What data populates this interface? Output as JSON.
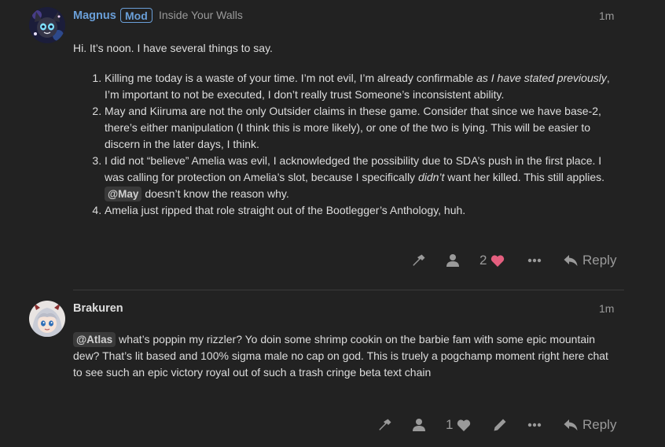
{
  "posts": [
    {
      "username": "Magnus",
      "badge": "Mod",
      "user_title": "Inside Your Walls",
      "time": "1m",
      "intro": "Hi. It’s noon. I have several things to say.",
      "list": {
        "item1_a": "Killing me today is a waste of your time. I’m not evil, I’m already confirmable ",
        "item1_em": "as I have stated previously",
        "item1_b": ", I’m important to not be executed, I don’t really trust Someone’s inconsistent ability.",
        "item2": "May and Kiiruma are not the only Outsider claims in these game. Consider that since we have base-2, there’s either manipulation (I think this is more likely), or one of the two is lying. This will be easier to discern in the later days, I think.",
        "item3_a": "I did not “believe” Amelia was evil, I acknowledged the possibility due to SDA’s push in the first place. I was calling for protection on Amelia’s slot, because I specifically ",
        "item3_em": "didn’t",
        "item3_b": " want her killed. This still applies. ",
        "item3_mention": "@May",
        "item3_c": " doesn’t know the reason why.",
        "item4": "Amelia just ripped that role straight out of the Bootlegger’s Anthology, huh."
      },
      "like_count": "2",
      "reply_label": "Reply",
      "accent_color": "#6a9fd8",
      "like_color": "#e45f7f"
    },
    {
      "username": "Brakuren",
      "time": "1m",
      "mention": "@Atlas",
      "text": " what’s poppin my rizzler? Yo doin some shrimp cookin on the barbie fam with some epic mountain dew? That’s lit based and 100% sigma male no cap on god. This is truely a pogchamp moment right here chat to see such an epic victory royal out of such a trash cringe beta text chain",
      "like_count": "1",
      "reply_label": "Reply"
    }
  ],
  "icons": [
    "wrench-icon",
    "user-icon",
    "heart-icon",
    "ellipsis-icon",
    "reply-icon",
    "pencil-icon"
  ]
}
